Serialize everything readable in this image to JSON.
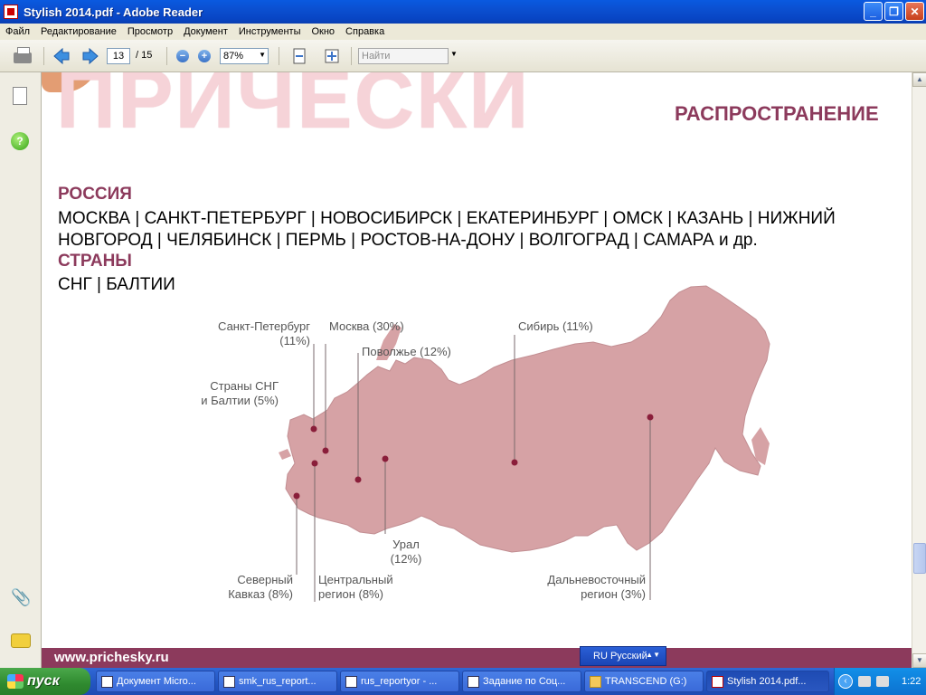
{
  "window": {
    "title": "Stylish 2014.pdf - Adobe Reader",
    "buttons": {
      "minimize": "_",
      "maximize": "❐",
      "close": "✕"
    }
  },
  "menu": [
    "Файл",
    "Редактирование",
    "Просмотр",
    "Документ",
    "Инструменты",
    "Окно",
    "Справка"
  ],
  "toolbar": {
    "page_current": "13",
    "page_total": "/ 15",
    "zoom_value": "87%",
    "find_placeholder": "Найти"
  },
  "document": {
    "big_word": "ПРИЧЕСКИ",
    "heading": "РАСПРОСТРАНЕНИЕ",
    "russia_title": "РОССИЯ",
    "russia_text": "МОСКВА | САНКТ-ПЕТЕРБУРГ | НОВОСИБИРСК | ЕКАТЕРИНБУРГ | ОМСК | КАЗАНЬ | НИЖНИЙ НОВГОРОД | ЧЕЛЯБИНСК | ПЕРМЬ | РОСТОВ-НА-ДОНУ | ВОЛГОГРАД | САМАРА и др.",
    "countries_title": "СТРАНЫ",
    "countries_text": "СНГ | БАЛТИИ",
    "map_labels": {
      "spb_1": "Санкт-Петербург",
      "spb_2": "(11%)",
      "moscow": "Москва (30%)",
      "volga": "Поволжье (12%)",
      "siberia": "Сибирь (11%)",
      "cis_1": "Страны СНГ",
      "cis_2": "и Балтии (5%)",
      "ural_1": "Урал",
      "ural_2": "(12%)",
      "caucasus_1": "Северный",
      "caucasus_2": "Кавказ (8%)",
      "central_1": "Центральный",
      "central_2": "регион (8%)",
      "fareast_1": "Дальневосточный",
      "fareast_2": "регион (3%)"
    },
    "footer_url": "www.prichesky.ru",
    "colors": {
      "accent": "#8c3a5c",
      "map_fill": "#d6a2a5",
      "marker": "#8a1e3a"
    }
  },
  "langbar": {
    "label": "RU Русский"
  },
  "taskbar": {
    "start_label": "пуск",
    "tasks": [
      {
        "label": "Документ Micro..."
      },
      {
        "label": "smk_rus_report..."
      },
      {
        "label": "rus_reportyor - ..."
      },
      {
        "label": "Задание по Соц..."
      },
      {
        "label": "TRANSCEND (G:)"
      },
      {
        "label": "Stylish 2014.pdf..."
      }
    ],
    "clock": "1:22"
  }
}
